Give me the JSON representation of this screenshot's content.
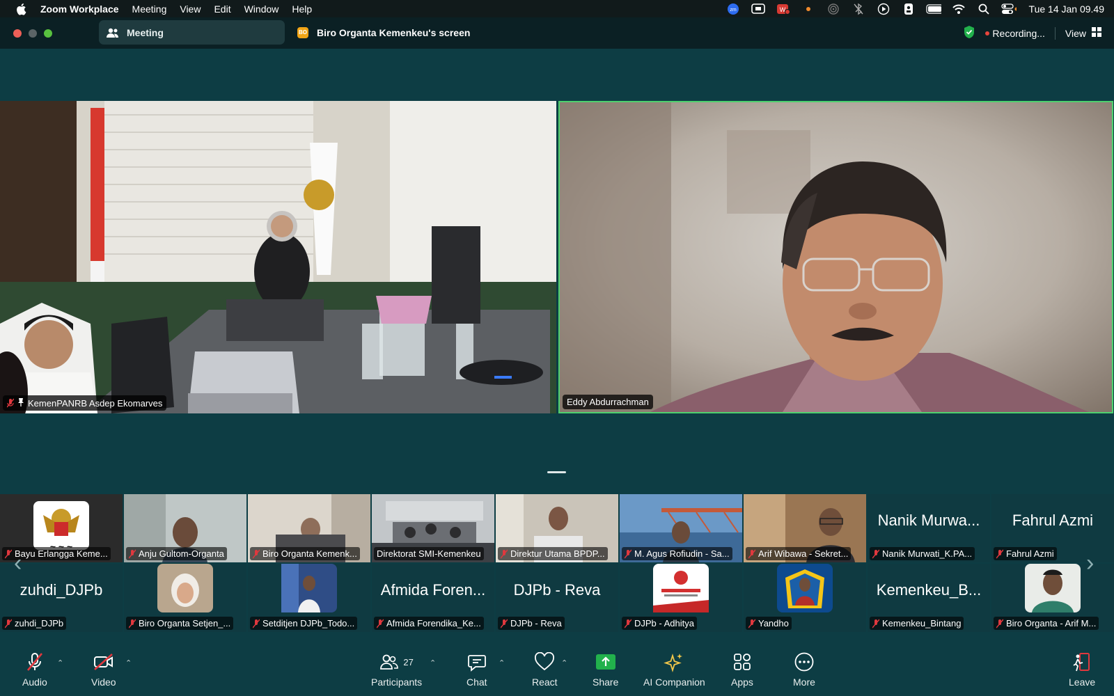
{
  "menubar": {
    "app": "Zoom Workplace",
    "items": [
      "Meeting",
      "View",
      "Edit",
      "Window",
      "Help"
    ],
    "clock": "Tue 14 Jan  09.49"
  },
  "titlebar": {
    "meeting_tab": "Meeting",
    "share_badge": "BO",
    "share_tab": "Biro Organta Kemenkeu's screen",
    "recording": "Recording...",
    "view": "View"
  },
  "main_videos": [
    {
      "name": "KemenPANRB Asdep Ekomarves"
    },
    {
      "name": "Eddy Abdurrachman"
    }
  ],
  "gallery": {
    "row1": [
      {
        "label": "Bayu Erlangga Keme..."
      },
      {
        "label": "Anju Gultom-Organta"
      },
      {
        "label": "Biro Organta Kemenk..."
      },
      {
        "label": "Direktorat SMI-Kemenkeu"
      },
      {
        "label": "Direktur Utama BPDP..."
      },
      {
        "label": "M. Agus Rofiudin - Sa..."
      },
      {
        "label": "Arif Wibawa - Sekret..."
      },
      {
        "big": "Nanik Murwa...",
        "label": "Nanik Murwati_K.PA..."
      },
      {
        "big": "Fahrul Azmi",
        "label": "Fahrul Azmi"
      }
    ],
    "row2": [
      {
        "big": "zuhdi_DJPb",
        "label": "zuhdi_DJPb"
      },
      {
        "label": "Biro Organta Setjen_..."
      },
      {
        "label": "Setditjen DJPb_Todo..."
      },
      {
        "big": "Afmida Foren...",
        "label": "Afmida Forendika_Ke..."
      },
      {
        "big": "DJPb - Reva",
        "label": "DJPb - Reva"
      },
      {
        "label": "DJPb - Adhitya"
      },
      {
        "label": "Yandho"
      },
      {
        "big": "Kemenkeu_B...",
        "label": "Kemenkeu_Bintang"
      },
      {
        "label": "Biro Organta - Arif M..."
      }
    ]
  },
  "toolbar": {
    "audio": "Audio",
    "video": "Video",
    "participants": "Participants",
    "participants_count": "27",
    "chat": "Chat",
    "react": "React",
    "share": "Share",
    "ai": "AI Companion",
    "apps": "Apps",
    "more": "More",
    "leave": "Leave"
  },
  "colors": {
    "background": "#0d3d44",
    "active_speaker": "#4ed16e",
    "share_green": "#22b14c",
    "mic_off_red": "#e0383e",
    "badge_orange": "#f2a516"
  }
}
